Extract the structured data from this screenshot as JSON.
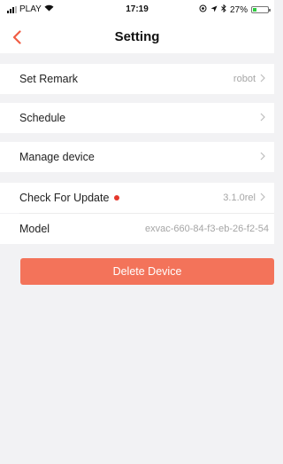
{
  "status_bar": {
    "carrier": "PLAY",
    "time": "17:19",
    "battery_percent": "27%",
    "battery_level": 0.27,
    "icons": [
      "signal-icon",
      "wifi-icon",
      "location-icon",
      "bluetooth-icon",
      "battery-icon"
    ]
  },
  "nav": {
    "back_icon": "chevron-left-icon",
    "title": "Setting"
  },
  "rows": {
    "remark": {
      "label": "Set Remark",
      "value": "robot"
    },
    "schedule": {
      "label": "Schedule"
    },
    "manage": {
      "label": "Manage device"
    },
    "update": {
      "label": "Check For Update",
      "value": "3.1.0rel"
    },
    "model": {
      "label": "Model",
      "value": "exvac-660-84-f3-eb-26-f2-54"
    }
  },
  "delete_button": {
    "label": "Delete Device"
  },
  "colors": {
    "accent": "#f05d44",
    "delete_button": "#f3735a",
    "update_dot": "#e5382c",
    "background": "#f2f2f4"
  }
}
